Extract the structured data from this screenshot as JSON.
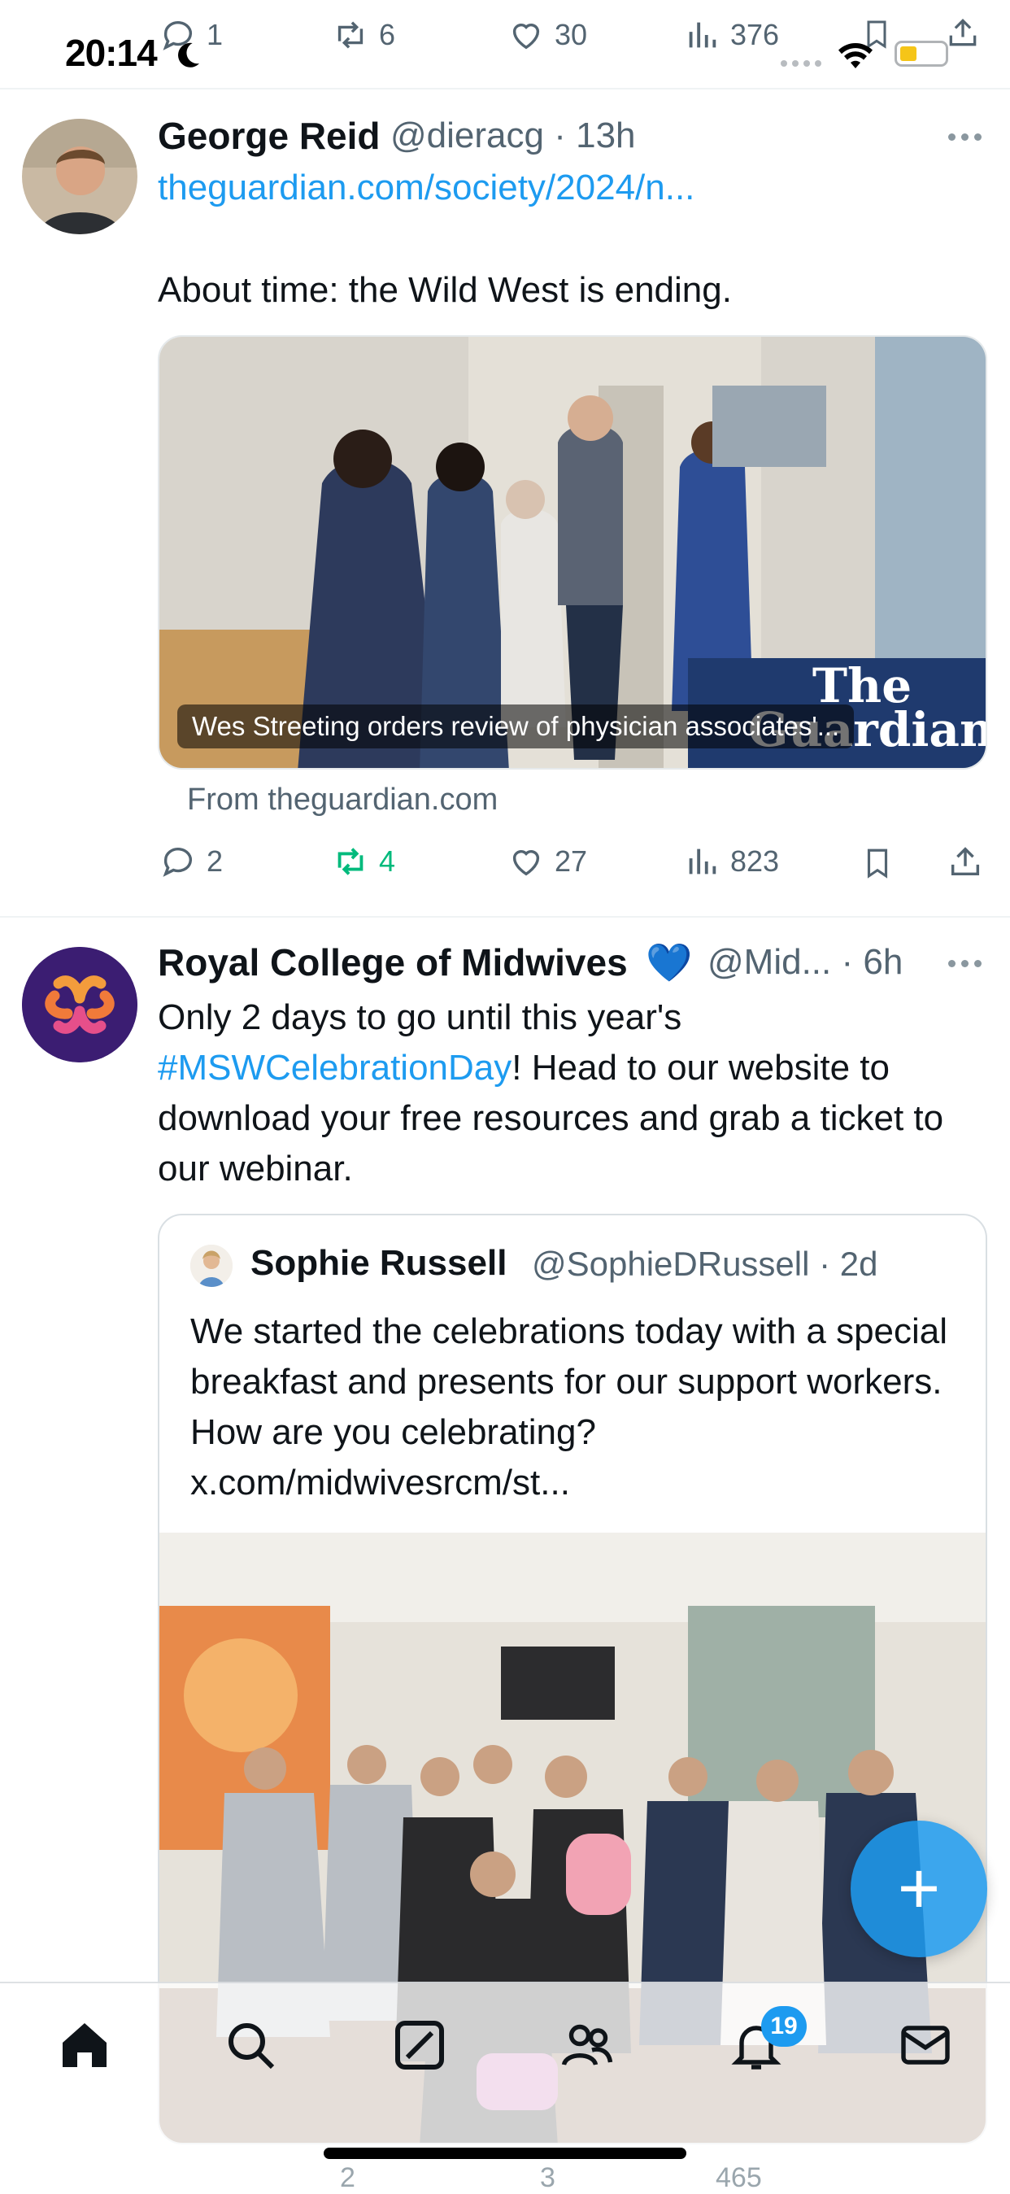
{
  "status_bar": {
    "time": "20:14"
  },
  "prev_tweet_actions": {
    "replies": "1",
    "reposts": "6",
    "likes": "30",
    "views": "376"
  },
  "tweet1": {
    "author": "George Reid",
    "handle": "@dieracg",
    "time": "· 13h",
    "link": "theguardian.com/society/2024/n...",
    "text": "About time: the Wild West is ending.",
    "card_caption": "Wes Streeting orders review of physician associates'...",
    "card_logo": "The Guardian",
    "card_source": "From theguardian.com",
    "replies": "2",
    "reposts": "4",
    "likes": "27",
    "views": "823"
  },
  "tweet2": {
    "author": "Royal College of Midwives",
    "verified_emoji": "💙",
    "handle": "@Mid...",
    "time": "· 6h",
    "text_part1": "Only 2 days to go until this year's ",
    "hashtag": "#MSWCelebrationDay",
    "text_part2": "! Head to our website to download your free resources and grab a ticket to our webinar.",
    "quote": {
      "author": "Sophie Russell",
      "handle": "@SophieDRussell",
      "time": "· 2d",
      "text": "We started the celebrations today with a special breakfast and presents for our support workers. How are you celebrating? x.com/midwivesrcm/st..."
    },
    "peek_reposts": "2",
    "peek_likes": "3",
    "peek_views": "465"
  },
  "nav": {
    "notifications_badge": "19"
  },
  "colors": {
    "accent": "#1d9bf0",
    "repost_active": "#00ba7c",
    "text": "#0f1419",
    "secondary": "#536471"
  }
}
